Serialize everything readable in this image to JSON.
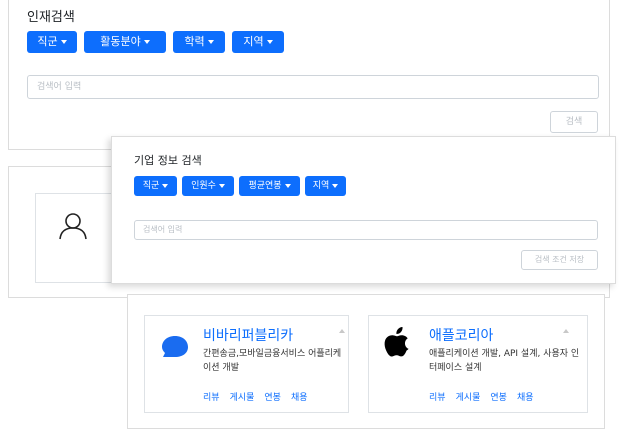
{
  "back_panel": {
    "title": "인재검색",
    "filters": [
      "직군",
      "활동분야",
      "학력",
      "지역"
    ],
    "search_placeholder": "검색어 입력",
    "search_button": "검색"
  },
  "front_panel": {
    "title": "기업 정보 검색",
    "filters": [
      "직군",
      "인원수",
      "평균연봉",
      "지역"
    ],
    "search_placeholder": "검색어 입력",
    "save_button": "검색 조건 저장"
  },
  "companies": [
    {
      "name": "비바리퍼블리카",
      "logo": "blue-speech-bubble-logo",
      "desc": "간편송금,모바일금융서비스 어플리케이션 개발",
      "links": [
        "리뷰",
        "게시물",
        "연봉",
        "채용"
      ]
    },
    {
      "name": "애플코리아",
      "logo": "apple-logo",
      "desc": "애플리케이션 개발, API 설계, 사용자 인터페이스 설계",
      "links": [
        "리뷰",
        "게시물",
        "연봉",
        "채용"
      ]
    }
  ],
  "colors": {
    "primary": "#0d6efd",
    "border": "#dcdcdc"
  }
}
